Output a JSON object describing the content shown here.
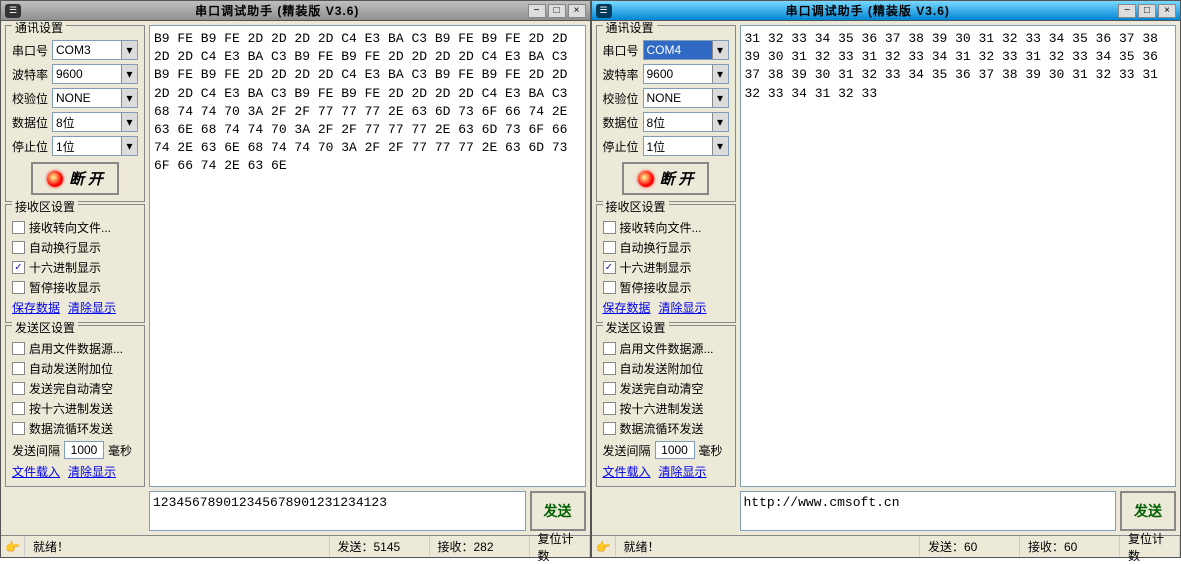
{
  "windows": [
    {
      "title": "串口调试助手 (精装版 V3.6)",
      "active": false,
      "comm": {
        "title": "通讯设置",
        "port_label": "串口号",
        "port": "COM3",
        "port_selected": false,
        "baud_label": "波特率",
        "baud": "9600",
        "parity_label": "校验位",
        "parity": "NONE",
        "databits_label": "数据位",
        "databits": "8位",
        "stopbits_label": "停止位",
        "stopbits": "1位",
        "disconnect": "断 开"
      },
      "rx": {
        "title": "接收区设置",
        "to_file": "接收转向文件...",
        "auto_wrap": "自动换行显示",
        "hex": "十六进制显示",
        "hex_checked": true,
        "pause": "暂停接收显示",
        "save": "保存数据",
        "clear": "清除显示"
      },
      "tx": {
        "title": "发送区设置",
        "file_src": "启用文件数据源...",
        "auto_extra": "自动发送附加位",
        "auto_clear": "发送完自动清空",
        "hex_send": "按十六进制发送",
        "loop": "数据流循环发送",
        "interval_label": "发送间隔",
        "interval": "1000",
        "interval_unit": "毫秒",
        "load_file": "文件载入",
        "clear": "清除显示"
      },
      "rx_data": "B9 FE B9 FE 2D 2D 2D 2D C4 E3 BA C3 B9 FE B9 FE 2D 2D 2D 2D C4 E3 BA C3 B9 FE B9 FE 2D 2D 2D 2D C4 E3 BA C3 B9 FE B9 FE 2D 2D 2D 2D C4 E3 BA C3 B9 FE B9 FE 2D 2D 2D 2D C4 E3 BA C3 B9 FE B9 FE 2D 2D 2D 2D C4 E3 BA C3 68 74 74 70 3A 2F 2F 77 77 77 2E 63 6D 73 6F 66 74 2E 63 6E 68 74 74 70 3A 2F 2F 77 77 77 2E 63 6D 73 6F 66 74 2E 63 6E 68 74 74 70 3A 2F 2F 77 77 77 2E 63 6D 73 6F 66 74 2E 63 6E",
      "tx_data": "123456789012345678901231234123",
      "send_btn": "发送",
      "status": {
        "ready": "就绪！",
        "tx_label": "发送：",
        "tx_count": "5145",
        "rx_label": "接收：",
        "rx_count": "282",
        "reset": "复位计数"
      }
    },
    {
      "title": "串口调试助手 (精装版 V3.6)",
      "active": true,
      "comm": {
        "title": "通讯设置",
        "port_label": "串口号",
        "port": "COM4",
        "port_selected": true,
        "baud_label": "波特率",
        "baud": "9600",
        "parity_label": "校验位",
        "parity": "NONE",
        "databits_label": "数据位",
        "databits": "8位",
        "stopbits_label": "停止位",
        "stopbits": "1位",
        "disconnect": "断 开"
      },
      "rx": {
        "title": "接收区设置",
        "to_file": "接收转向文件...",
        "auto_wrap": "自动换行显示",
        "hex": "十六进制显示",
        "hex_checked": true,
        "pause": "暂停接收显示",
        "save": "保存数据",
        "clear": "清除显示"
      },
      "tx": {
        "title": "发送区设置",
        "file_src": "启用文件数据源...",
        "auto_extra": "自动发送附加位",
        "auto_clear": "发送完自动清空",
        "hex_send": "按十六进制发送",
        "loop": "数据流循环发送",
        "interval_label": "发送间隔",
        "interval": "1000",
        "interval_unit": "毫秒",
        "load_file": "文件载入",
        "clear": "清除显示"
      },
      "rx_data": "31 32 33 34 35 36 37 38 39 30 31 32 33 34 35 36 37 38 39 30 31 32 33 31 32 33 34 31 32 33 31 32 33 34 35 36 37 38 39 30 31 32 33 34 35 36 37 38 39 30 31 32 33 31 32 33 34 31 32 33",
      "tx_data": "http://www.cmsoft.cn",
      "send_btn": "发送",
      "status": {
        "ready": "就绪！",
        "tx_label": "发送：",
        "tx_count": "60",
        "rx_label": "接收：",
        "rx_count": "60",
        "reset": "复位计数"
      }
    }
  ]
}
